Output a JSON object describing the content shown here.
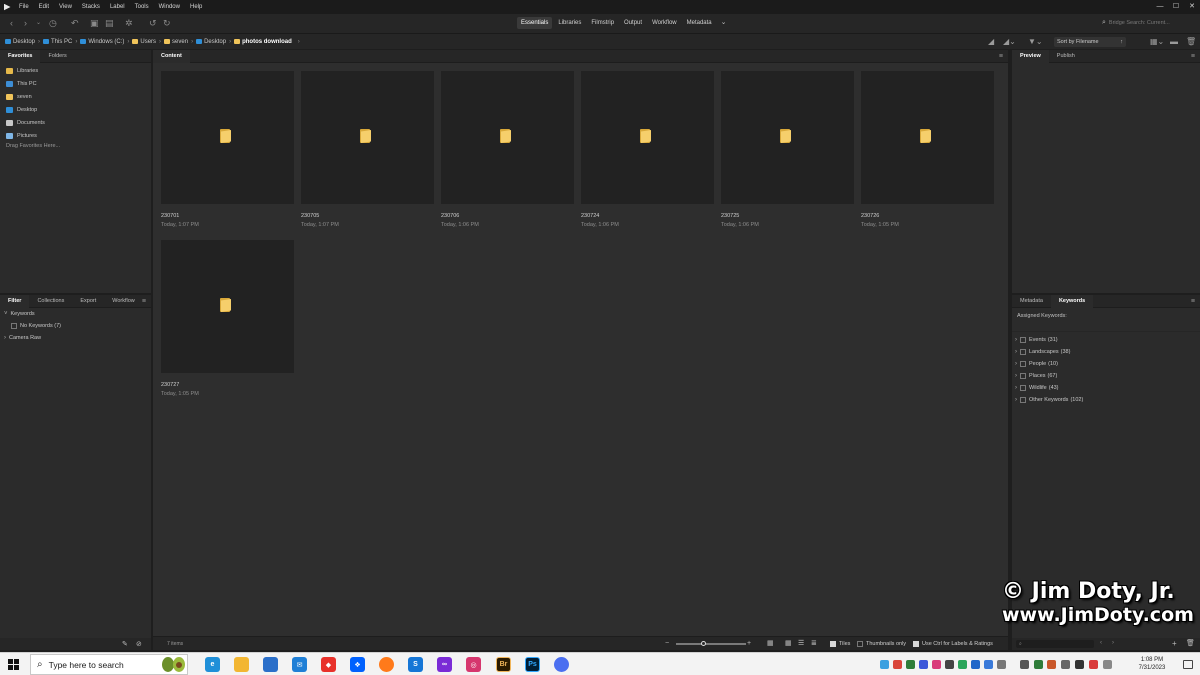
{
  "menu": [
    "File",
    "Edit",
    "View",
    "Stacks",
    "Label",
    "Tools",
    "Window",
    "Help"
  ],
  "window_controls": {
    "minimize": "—",
    "maximize": "☐",
    "close": "✕"
  },
  "workspaces": [
    {
      "label": "Essentials",
      "active": true
    },
    {
      "label": "Libraries",
      "active": false
    },
    {
      "label": "Filmstrip",
      "active": false
    },
    {
      "label": "Output",
      "active": false
    },
    {
      "label": "Workflow",
      "active": false
    },
    {
      "label": "Metadata",
      "active": false
    }
  ],
  "search_placeholder": "Bridge Search: Current...",
  "breadcrumb": [
    {
      "label": "Desktop",
      "icon": "blue"
    },
    {
      "label": "This PC",
      "icon": "blue"
    },
    {
      "label": "Windows (C:)",
      "icon": "blue"
    },
    {
      "label": "Users",
      "icon": "yellow"
    },
    {
      "label": "seven",
      "icon": "yellow"
    },
    {
      "label": "Desktop",
      "icon": "blue"
    },
    {
      "label": "photos download",
      "icon": "yellow",
      "current": true
    }
  ],
  "sort_label": "Sort by Filename",
  "favorites_panel": {
    "tabs": [
      "Favorites",
      "Folders"
    ],
    "items": [
      {
        "label": "Libraries",
        "color": "#e6b94a"
      },
      {
        "label": "This PC",
        "color": "#3d8ed6"
      },
      {
        "label": "seven",
        "color": "#f0c45a"
      },
      {
        "label": "Desktop",
        "color": "#2f8fd8"
      },
      {
        "label": "Documents",
        "color": "#c8c8c8"
      },
      {
        "label": "Pictures",
        "color": "#7fb6e6"
      }
    ],
    "hint": "Drag Favorites Here..."
  },
  "filter_panel": {
    "tabs": [
      "Filter",
      "Collections",
      "Export",
      "Workflow"
    ],
    "keywords_label": "Keywords",
    "no_keywords": "No Keywords (7)",
    "camera_raw": "Camera Raw"
  },
  "content": {
    "tab": "Content",
    "items": [
      {
        "name": "230701",
        "date": "Today, 1:07 PM"
      },
      {
        "name": "230705",
        "date": "Today, 1:07 PM"
      },
      {
        "name": "230706",
        "date": "Today, 1:06 PM"
      },
      {
        "name": "230724",
        "date": "Today, 1:06 PM"
      },
      {
        "name": "230725",
        "date": "Today, 1:06 PM"
      },
      {
        "name": "230726",
        "date": "Today, 1:05 PM"
      },
      {
        "name": "230727",
        "date": "Today, 1:05 PM"
      }
    ],
    "item_count": "7 items",
    "zoom_level": 0.4,
    "tiles_label": "Tiles",
    "thumbnails_only_label": "Thumbnails only",
    "ctrl_labels": "Use Ctrl for Labels & Ratings"
  },
  "preview_panel": {
    "tabs": [
      "Preview",
      "Publish"
    ]
  },
  "meta_panel": {
    "tabs": [
      "Metadata",
      "Keywords"
    ],
    "assigned": "Assigned Keywords:",
    "keywords": [
      {
        "label": "Events",
        "count": "(31)"
      },
      {
        "label": "Landscapes",
        "count": "(38)"
      },
      {
        "label": "People",
        "count": "(10)"
      },
      {
        "label": "Places",
        "count": "(67)"
      },
      {
        "label": "Wildlife",
        "count": "(43)"
      },
      {
        "label": "Other Keywords",
        "count": "(102)"
      }
    ]
  },
  "watermark": {
    "line1": "© Jim Doty, Jr.",
    "line2": "www.JimDoty.com"
  },
  "taskbar": {
    "search_placeholder": "Type here to search",
    "apps": [
      {
        "name": "edge",
        "color": "#1f8fd8",
        "glyph": "e"
      },
      {
        "name": "file-explorer",
        "color": "#f2b632",
        "glyph": ""
      },
      {
        "name": "store",
        "color": "#2b6fc9",
        "glyph": ""
      },
      {
        "name": "mail",
        "color": "#1f7fd6",
        "glyph": "✉"
      },
      {
        "name": "app-red",
        "color": "#e8312a",
        "glyph": "◆"
      },
      {
        "name": "dropbox",
        "color": "#0061fe",
        "glyph": "❖"
      },
      {
        "name": "firefox",
        "color": "#ff7a1a",
        "glyph": ""
      },
      {
        "name": "app-blue",
        "color": "#1576d6",
        "glyph": "S"
      },
      {
        "name": "app-purple",
        "color": "#7a2bd6",
        "glyph": "∞"
      },
      {
        "name": "app-gradient",
        "color": "#d6366e",
        "glyph": "◎"
      },
      {
        "name": "bridge",
        "color": "#2a1a00",
        "glyph": "Br"
      },
      {
        "name": "photoshop",
        "color": "#001e36",
        "glyph": "Ps"
      },
      {
        "name": "app-orb",
        "color": "#4b6ff0",
        "glyph": ""
      }
    ],
    "time": "1:08 PM",
    "date": "7/31/2023"
  }
}
